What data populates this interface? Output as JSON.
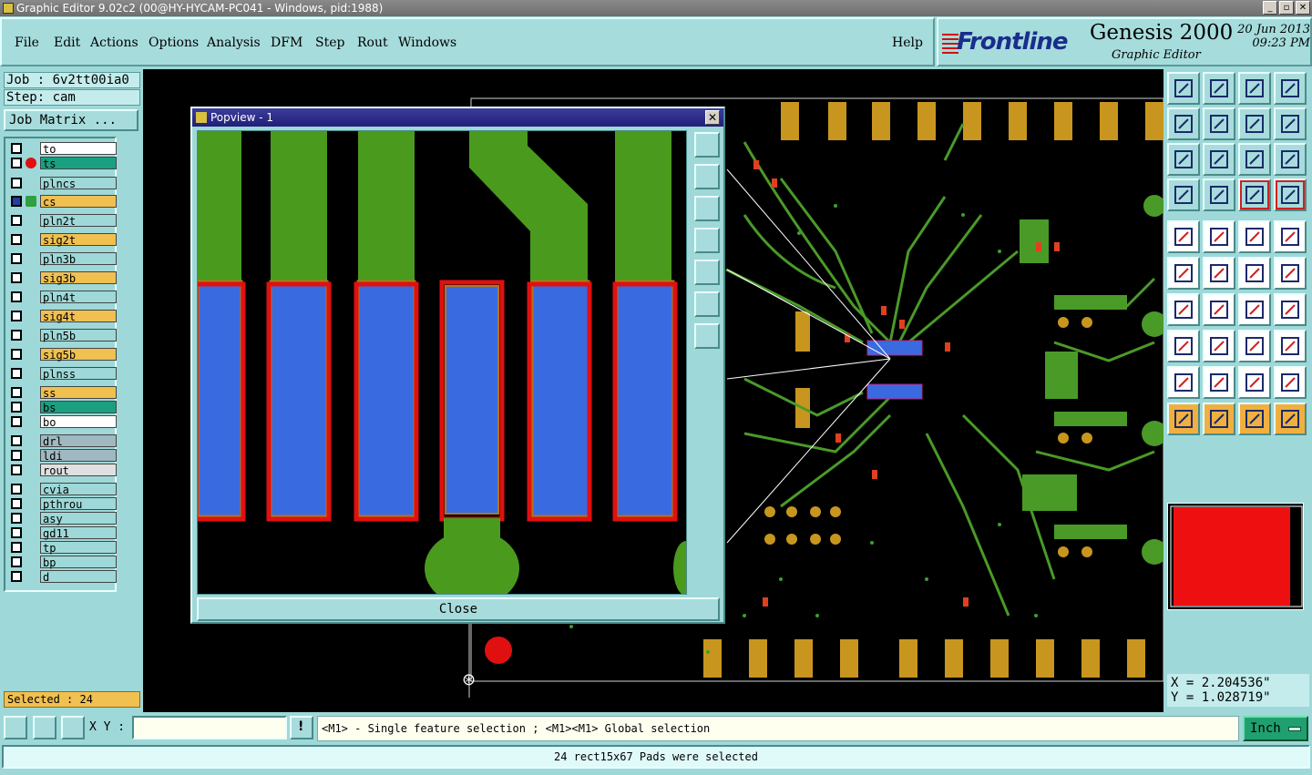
{
  "window": {
    "title": "Graphic Editor 9.02c2 (00@HY-HYCAM-PC041 - Windows, pid:1988)"
  },
  "menu": [
    "File",
    "Edit",
    "Actions",
    "Options",
    "Analysis",
    "DFM",
    "Step",
    "Rout",
    "Windows"
  ],
  "help": "Help",
  "brand": {
    "logo": "Frontline",
    "product": "Genesis 2000",
    "subtitle": "Graphic Editor",
    "date": "20 Jun 2013",
    "time": "09:23 PM"
  },
  "job": {
    "job": "Job : 6v2tt00ia0",
    "step": "Step: cam",
    "matrix_button": "Job Matrix ..."
  },
  "layers": [
    {
      "name": "to",
      "color": "#ffffff"
    },
    {
      "name": "ts",
      "color": "#1aa080",
      "active": true
    },
    {
      "name": "plncs",
      "color": "#9fd8d8"
    },
    {
      "name": "cs",
      "color": "#f0c050",
      "work": true
    },
    {
      "name": "pln2t",
      "color": "#9fd8d8"
    },
    {
      "name": "sig2t",
      "color": "#f0c050"
    },
    {
      "name": "pln3b",
      "color": "#9fd8d8"
    },
    {
      "name": "sig3b",
      "color": "#f0c050"
    },
    {
      "name": "pln4t",
      "color": "#9fd8d8"
    },
    {
      "name": "sig4t",
      "color": "#f0c050"
    },
    {
      "name": "pln5b",
      "color": "#9fd8d8"
    },
    {
      "name": "sig5b",
      "color": "#f0c050"
    },
    {
      "name": "plnss",
      "color": "#9fd8d8"
    },
    {
      "name": "ss",
      "color": "#f0c050"
    },
    {
      "name": "bs",
      "color": "#1aa080"
    },
    {
      "name": "bo",
      "color": "#ffffff"
    },
    {
      "name": "drl",
      "color": "#a0b8c0"
    },
    {
      "name": "ldi",
      "color": "#a0b8c0"
    },
    {
      "name": "rout",
      "color": "#e0e0e0"
    },
    {
      "name": "cvia",
      "color": "#9fd8d8"
    },
    {
      "name": "pthrou",
      "color": "#9fd8d8"
    },
    {
      "name": "asy",
      "color": "#9fd8d8"
    },
    {
      "name": "gd11",
      "color": "#9fd8d8"
    },
    {
      "name": "tp",
      "color": "#9fd8d8"
    },
    {
      "name": "bp",
      "color": "#9fd8d8"
    },
    {
      "name": "d",
      "color": "#9fd8d8"
    }
  ],
  "selected": "Selected : 24",
  "popview": {
    "title": "Popview - 1",
    "close": "Close"
  },
  "coords": {
    "x": "X = 2.204536\"",
    "y": "Y = 1.028719\""
  },
  "bottom": {
    "xy_label": "X Y :",
    "xy_value": "",
    "message": "<M1> - Single feature selection ; <M1><M1> Global selection",
    "units": "Inch"
  },
  "status": "24 rect15x67 Pads were selected"
}
